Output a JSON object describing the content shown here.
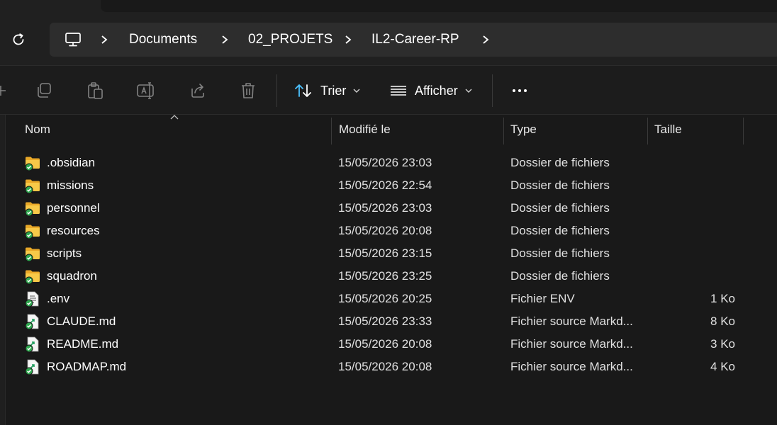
{
  "breadcrumb": {
    "root_icon": "this-pc-icon",
    "items": [
      {
        "label": "Documents"
      },
      {
        "label": "02_PROJETS"
      },
      {
        "label": "IL2-Career-RP"
      }
    ]
  },
  "toolbar": {
    "icons": [
      "new-item-icon",
      "copy-icon",
      "paste-icon",
      "rename-icon",
      "share-icon",
      "delete-icon"
    ],
    "sort_label": "Trier",
    "view_label": "Afficher",
    "more_icon": "more-options-icon"
  },
  "columns": {
    "name": "Nom",
    "modified": "Modifié le",
    "type": "Type",
    "size": "Taille"
  },
  "files": [
    {
      "name": ".obsidian",
      "modified": "15/05/2026 23:03",
      "type": "Dossier de fichiers",
      "size": "",
      "icon": "folder-synced-icon"
    },
    {
      "name": "missions",
      "modified": "15/05/2026 22:54",
      "type": "Dossier de fichiers",
      "size": "",
      "icon": "folder-synced-icon"
    },
    {
      "name": "personnel",
      "modified": "15/05/2026 23:03",
      "type": "Dossier de fichiers",
      "size": "",
      "icon": "folder-synced-icon"
    },
    {
      "name": "resources",
      "modified": "15/05/2026 20:08",
      "type": "Dossier de fichiers",
      "size": "",
      "icon": "folder-synced-icon"
    },
    {
      "name": "scripts",
      "modified": "15/05/2026 23:15",
      "type": "Dossier de fichiers",
      "size": "",
      "icon": "folder-synced-icon"
    },
    {
      "name": "squadron",
      "modified": "15/05/2026 23:25",
      "type": "Dossier de fichiers",
      "size": "",
      "icon": "folder-synced-icon"
    },
    {
      "name": ".env",
      "modified": "15/05/2026 20:25",
      "type": "Fichier ENV",
      "size": "1 Ko",
      "icon": "text-file-synced-icon"
    },
    {
      "name": "CLAUDE.md",
      "modified": "15/05/2026 23:33",
      "type": "Fichier source Markd...",
      "size": "8 Ko",
      "icon": "markdown-file-synced-icon"
    },
    {
      "name": "README.md",
      "modified": "15/05/2026 20:08",
      "type": "Fichier source Markd...",
      "size": "3 Ko",
      "icon": "markdown-file-synced-icon"
    },
    {
      "name": "ROADMAP.md",
      "modified": "15/05/2026 20:08",
      "type": "Fichier source Markd...",
      "size": "4 Ko",
      "icon": "markdown-file-synced-icon"
    }
  ],
  "colors": {
    "background": "#191919",
    "folder": "#f2c34a",
    "sync_badge": "#2fa84f",
    "accent": "#4cc2ff"
  }
}
